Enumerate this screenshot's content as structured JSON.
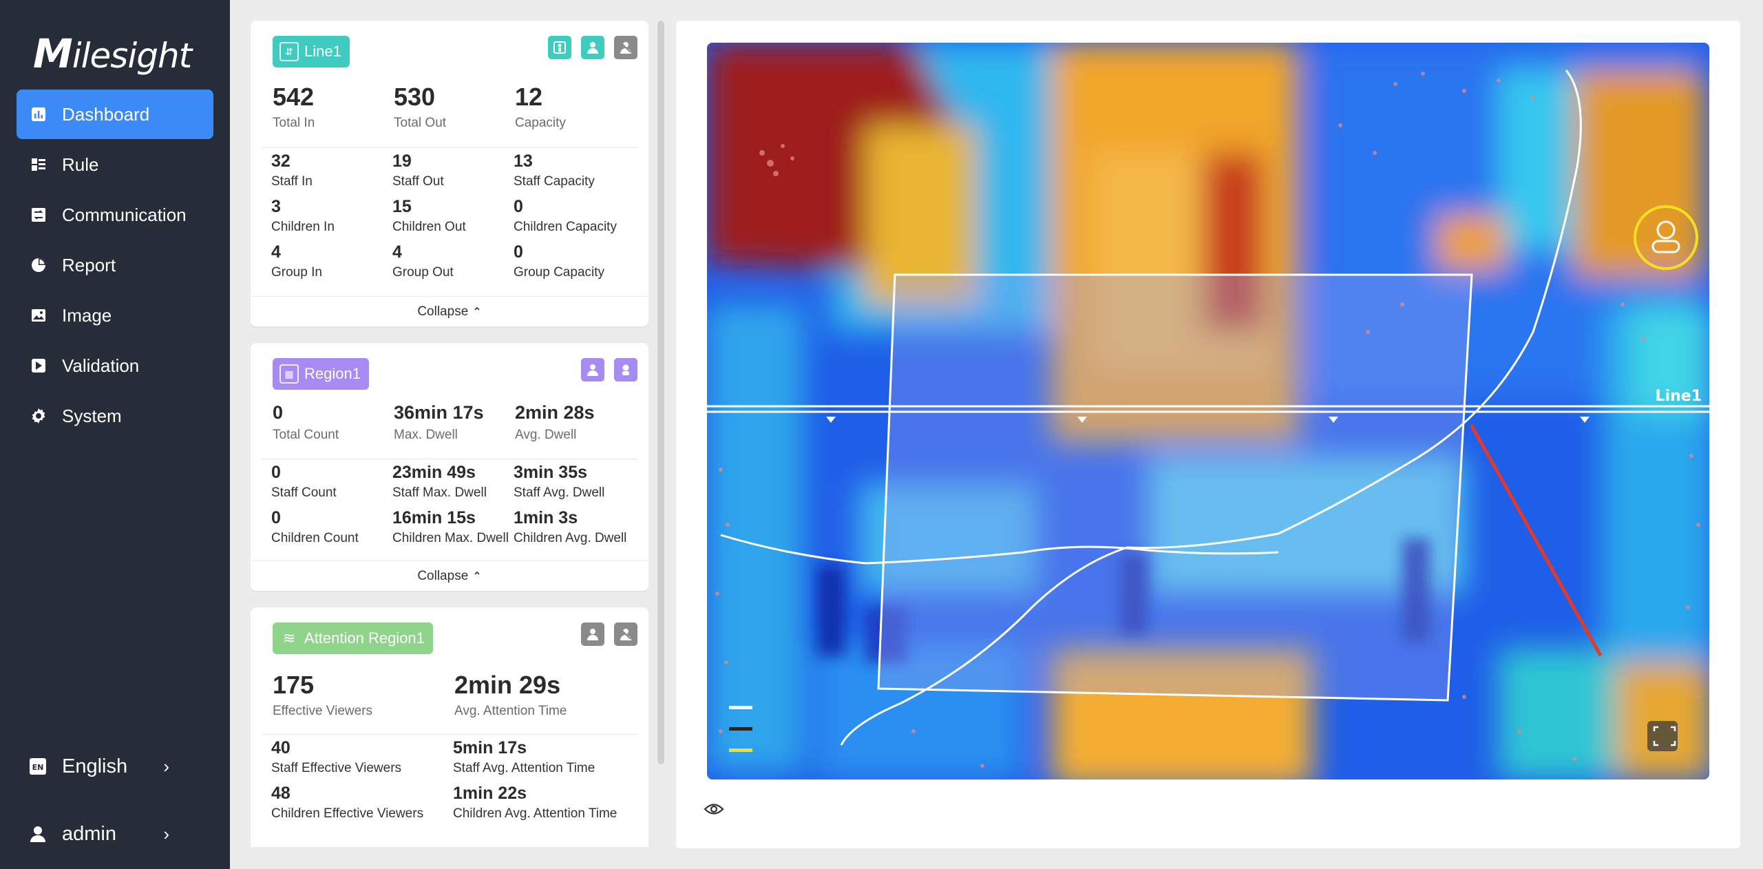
{
  "brand": {
    "logo_prefix": "M",
    "logo_rest": "ilesight"
  },
  "nav": {
    "items": [
      {
        "label": "Dashboard",
        "active": true,
        "icon": "bar-chart-icon"
      },
      {
        "label": "Rule",
        "icon": "rule-grid-icon"
      },
      {
        "label": "Communication",
        "icon": "communication-icon"
      },
      {
        "label": "Report",
        "icon": "pie-chart-icon"
      },
      {
        "label": "Image",
        "icon": "image-icon"
      },
      {
        "label": "Validation",
        "icon": "validation-icon"
      },
      {
        "label": "System",
        "icon": "gear-icon"
      }
    ],
    "language": {
      "label": "English",
      "icon_text": "EN"
    },
    "user": {
      "label": "admin"
    }
  },
  "line_card": {
    "tag": "Line1",
    "main": [
      {
        "value": "542",
        "label": "Total In"
      },
      {
        "value": "530",
        "label": "Total Out"
      },
      {
        "value": "12",
        "label": "Capacity"
      }
    ],
    "details": [
      {
        "value": "32",
        "label": "Staff In"
      },
      {
        "value": "19",
        "label": "Staff Out"
      },
      {
        "value": "13",
        "label": "Staff Capacity"
      },
      {
        "value": "3",
        "label": "Children In"
      },
      {
        "value": "15",
        "label": "Children Out"
      },
      {
        "value": "0",
        "label": "Children Capacity"
      },
      {
        "value": "4",
        "label": "Group In"
      },
      {
        "value": "4",
        "label": "Group Out"
      },
      {
        "value": "0",
        "label": "Group Capacity"
      }
    ],
    "collapse": "Collapse"
  },
  "region_card": {
    "tag": "Region1",
    "main": [
      {
        "value": "0",
        "label": "Total Count"
      },
      {
        "value": "36min 17s",
        "label": "Max. Dwell"
      },
      {
        "value": "2min 28s",
        "label": "Avg. Dwell"
      }
    ],
    "details": [
      {
        "value": "0",
        "label": "Staff Count"
      },
      {
        "value": "23min 49s",
        "label": "Staff Max. Dwell"
      },
      {
        "value": "3min 35s",
        "label": "Staff Avg. Dwell"
      },
      {
        "value": "0",
        "label": "Children Count"
      },
      {
        "value": "16min 15s",
        "label": "Children Max. Dwell"
      },
      {
        "value": "1min 3s",
        "label": "Children Avg. Dwell"
      }
    ],
    "collapse": "Collapse"
  },
  "attention_card": {
    "tag": "Attention Region1",
    "main": [
      {
        "value": "175",
        "label": "Effective Viewers"
      },
      {
        "value": "2min 29s",
        "label": "Avg. Attention Time"
      }
    ],
    "details": [
      {
        "value": "40",
        "label": "Staff Effective Viewers"
      },
      {
        "value": "5min 17s",
        "label": "Staff Avg. Attention Time"
      },
      {
        "value": "48",
        "label": "Children Effective Viewers"
      },
      {
        "value": "1min 22s",
        "label": "Children Avg. Attention Time"
      }
    ]
  },
  "image": {
    "line_label": "Line1"
  },
  "colors": {
    "sidebar": "#262c38",
    "accent": "#3b8af6",
    "teal": "#3fcbbf",
    "purple": "#a78bf2",
    "green": "#8fd48a"
  }
}
